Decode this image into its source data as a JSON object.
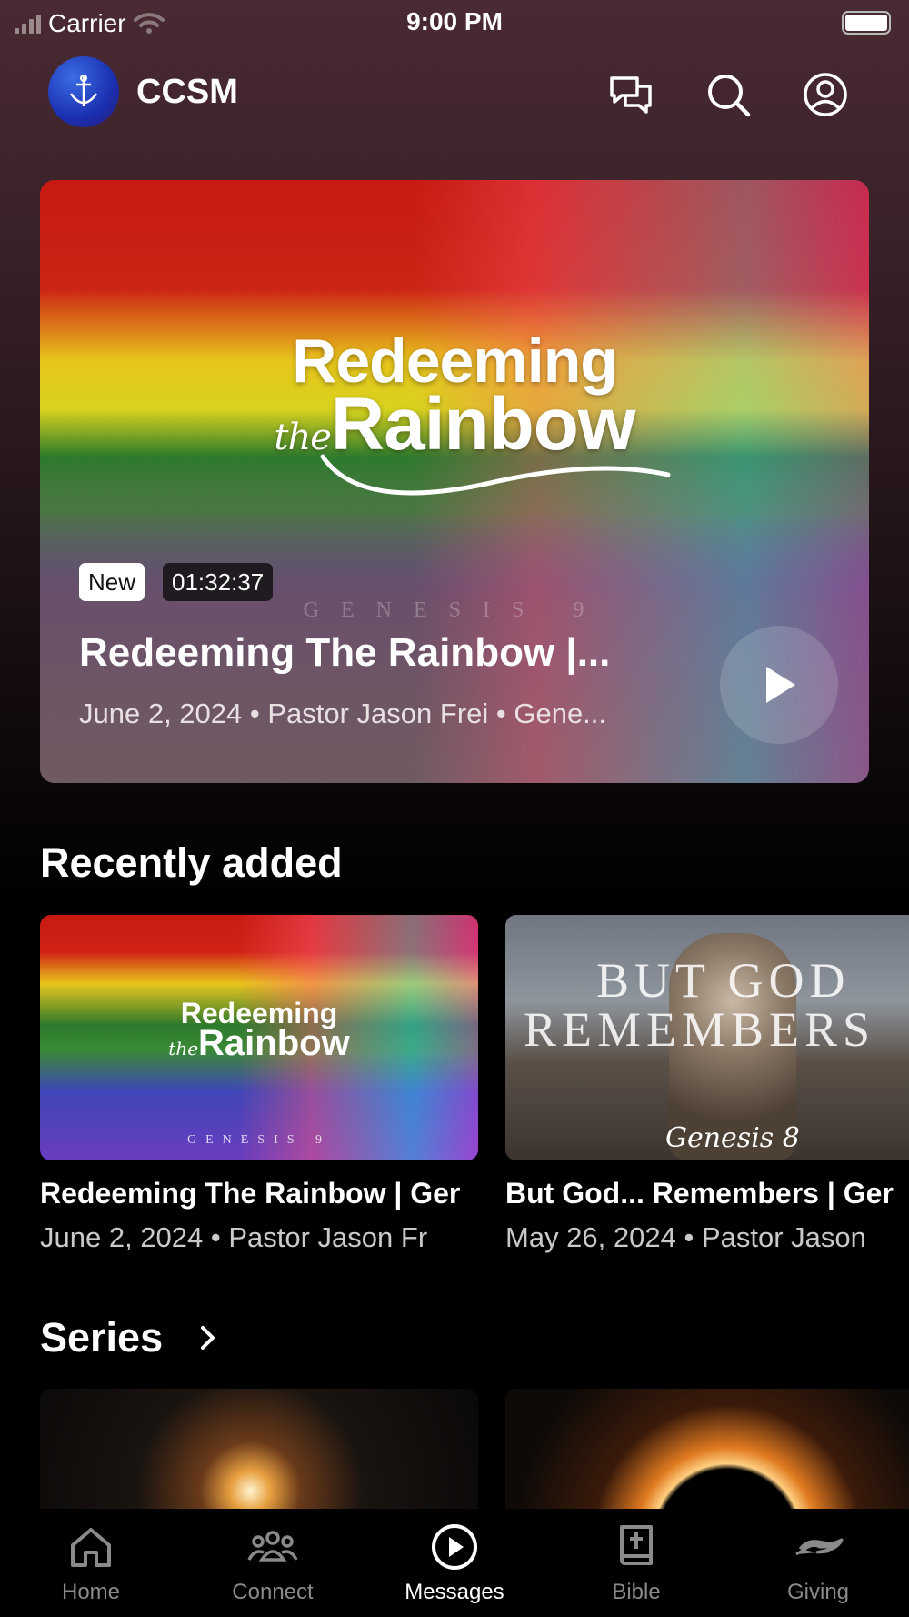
{
  "status_bar": {
    "carrier": "Carrier",
    "time": "9:00 PM"
  },
  "header": {
    "app_name": "CCSM"
  },
  "hero": {
    "art_line1": "Redeeming",
    "art_the": "the",
    "art_line2": "Rainbow",
    "art_sub": "GENESIS 9",
    "badge_new": "New",
    "duration": "01:32:37",
    "title": "Redeeming The Rainbow |...",
    "meta": "June 2, 2024 • Pastor Jason Frei • Gene..."
  },
  "recently_added": {
    "heading": "Recently added",
    "items": [
      {
        "title": "Redeeming The Rainbow | Ger",
        "meta": "June 2, 2024 • Pastor Jason Fr",
        "art_line1": "Redeeming",
        "art_the": "the",
        "art_line2": "Rainbow",
        "art_sub": "GENESIS 9"
      },
      {
        "title": "But God... Remembers | Ger",
        "meta": "May 26, 2024 • Pastor Jason",
        "art_line1": "BUT GOD",
        "art_line2": "REMEMBERS",
        "art_sub": "Genesis 8"
      }
    ]
  },
  "series": {
    "heading": "Series"
  },
  "tabs": [
    {
      "label": "Home",
      "icon": "home-icon"
    },
    {
      "label": "Connect",
      "icon": "people-icon"
    },
    {
      "label": "Messages",
      "icon": "play-circle-icon"
    },
    {
      "label": "Bible",
      "icon": "bible-icon"
    },
    {
      "label": "Giving",
      "icon": "giving-hand-icon"
    }
  ],
  "colors": {
    "background": "#000000",
    "header_tint": "#4a2a32",
    "inactive_tab": "#8a8a8a"
  }
}
